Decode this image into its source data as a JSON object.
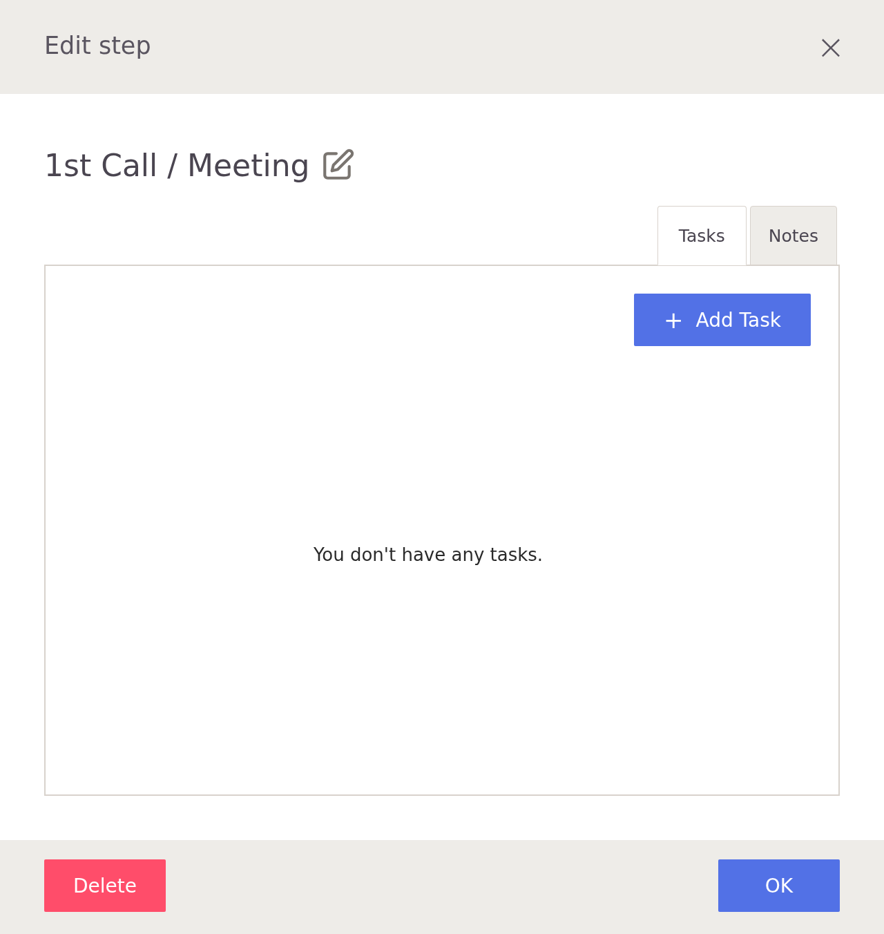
{
  "dialog": {
    "title": "Edit step",
    "close_label": "×"
  },
  "step": {
    "name": "1st Call / Meeting"
  },
  "tabs": [
    {
      "label": "Tasks",
      "selected": true
    },
    {
      "label": "Notes",
      "selected": false
    }
  ],
  "tasks": {
    "add_button": {
      "icon": "+",
      "label": "Add Task"
    },
    "empty_message": "You don't have any tasks."
  },
  "footer": {
    "buttons": [
      {
        "label": "Delete",
        "kind": "danger"
      },
      {
        "label": "OK",
        "kind": "primary"
      }
    ]
  }
}
